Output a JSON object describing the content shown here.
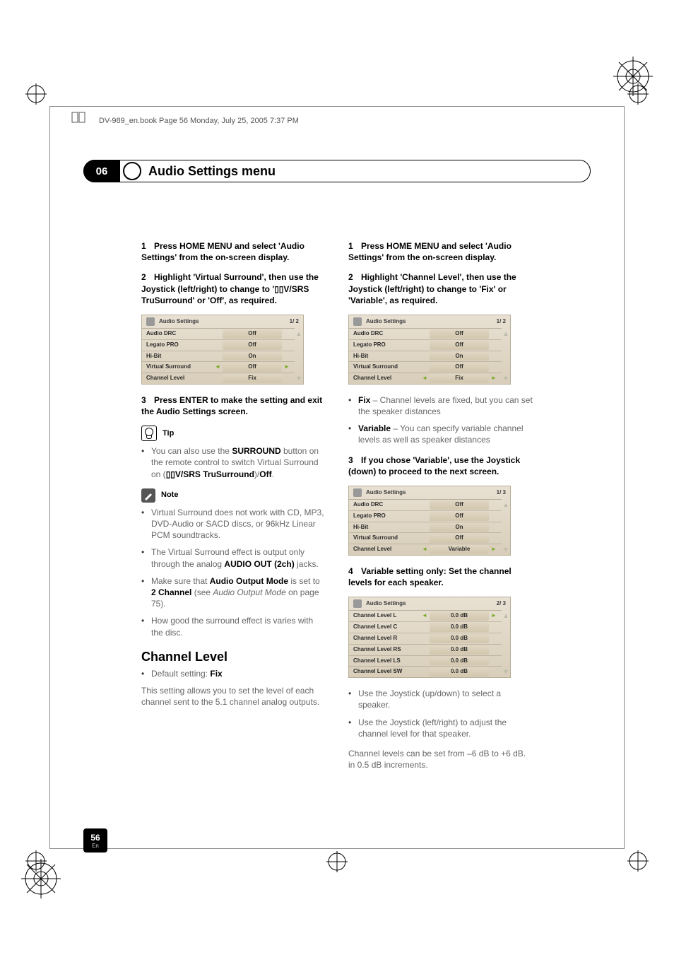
{
  "header_note": "DV-989_en.book  Page 56  Monday, July 25, 2005  7:37 PM",
  "chapter": {
    "number": "06",
    "title": "Audio Settings menu"
  },
  "page": {
    "number": "56",
    "lang": "En"
  },
  "left": {
    "step1": {
      "n": "1",
      "text": "Press HOME MENU and select 'Audio Settings' from the on-screen display."
    },
    "step2": {
      "n": "2",
      "text": "Highlight 'Virtual Surround', then use the Joystick (left/right) to change to '▯▯V/SRS TruSurround' or 'Off', as required."
    },
    "panel1": {
      "title": "Audio Settings",
      "pager": "1/ 2",
      "rows": [
        {
          "lbl": "Audio DRC",
          "val": "Off",
          "la": "",
          "ra": ""
        },
        {
          "lbl": "Legato PRO",
          "val": "Off"
        },
        {
          "lbl": "Hi-Bit",
          "val": "On"
        },
        {
          "lbl": "Virtual Surround",
          "val": "Off",
          "la": "◄",
          "ra": "►"
        },
        {
          "lbl": "Channel Level",
          "val": "Fix"
        }
      ]
    },
    "step3": {
      "n": "3",
      "text": "Press ENTER to make the setting and exit the Audio Settings screen."
    },
    "tip_label": "Tip",
    "tip_bullets": [
      "You can also use the <b>SURROUND</b> button on the remote control to switch Virtual Surround on (<b>▯▯V/SRS TruSurround</b>)/<b>Off</b>."
    ],
    "note_label": "Note",
    "note_bullets": [
      "Virtual Surround does not work with CD, MP3, DVD-Audio or SACD discs, or 96kHz Linear PCM soundtracks.",
      "The Virtual Surround effect is output only through the analog <b>AUDIO OUT (2ch)</b> jacks.",
      "Make sure that <b>Audio Output Mode</b> is set to <b>2 Channel</b> (see <i>Audio Output Mode</i> on page 75).",
      "How good the surround effect is varies with the disc."
    ],
    "h2": "Channel Level",
    "default_line": "Default setting: <b>Fix</b>",
    "body": "This setting allows you to set the level of each channel sent to the 5.1 channel analog outputs."
  },
  "right": {
    "step1": {
      "n": "1",
      "text": "Press HOME MENU and select 'Audio Settings' from the on-screen display."
    },
    "step2": {
      "n": "2",
      "text": "Highlight 'Channel Level', then use the Joystick (left/right) to change to 'Fix' or 'Variable', as required."
    },
    "panel1": {
      "title": "Audio Settings",
      "pager": "1/ 2",
      "rows": [
        {
          "lbl": "Audio DRC",
          "val": "Off"
        },
        {
          "lbl": "Legato PRO",
          "val": "Off"
        },
        {
          "lbl": "Hi-Bit",
          "val": "On"
        },
        {
          "lbl": "Virtual Surround",
          "val": "Off"
        },
        {
          "lbl": "Channel Level",
          "val": "Fix",
          "la": "◄",
          "ra": "►"
        }
      ]
    },
    "fix_variable": [
      "<b>Fix</b> – Channel levels are fixed, but you can set the speaker distances",
      "<b>Variable</b> – You can specify variable channel levels as well as speaker distances"
    ],
    "step3": {
      "n": "3",
      "text": "If you chose 'Variable', use the Joystick (down) to proceed to the next screen."
    },
    "panel2": {
      "title": "Audio Settings",
      "pager": "1/ 3",
      "rows": [
        {
          "lbl": "Audio DRC",
          "val": "Off"
        },
        {
          "lbl": "Legato PRO",
          "val": "Off"
        },
        {
          "lbl": "Hi-Bit",
          "val": "On"
        },
        {
          "lbl": "Virtual Surround",
          "val": "Off"
        },
        {
          "lbl": "Channel Level",
          "val": "Variable",
          "la": "◄",
          "ra": "►"
        }
      ]
    },
    "step4": {
      "n": "4",
      "text": "Variable setting only: Set the channel levels for each speaker."
    },
    "panel3": {
      "title": "Audio Settings",
      "pager": "2/ 3",
      "rows": [
        {
          "lbl": "Channel Level L",
          "val": "0.0 dB",
          "la": "◄",
          "ra": "►"
        },
        {
          "lbl": "Channel Level C",
          "val": "0.0 dB"
        },
        {
          "lbl": "Channel Level R",
          "val": "0.0 dB"
        },
        {
          "lbl": "Channel Level RS",
          "val": "0.0 dB"
        },
        {
          "lbl": "Channel Level LS",
          "val": "0.0 dB"
        },
        {
          "lbl": "Channel Level SW",
          "val": "0.0 dB"
        }
      ]
    },
    "joy_bullets": [
      "Use the Joystick (up/down) to select a speaker.",
      "Use the Joystick (left/right) to adjust the channel level for that speaker."
    ],
    "tail": "Channel levels can be set from –6 dB to +6 dB. in 0.5 dB increments."
  }
}
